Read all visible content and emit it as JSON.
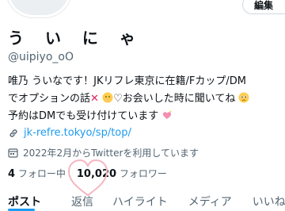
{
  "header": {
    "edit_label": "編集"
  },
  "profile": {
    "display_name": "う い に ゃ",
    "handle": "@uipiyo_oO",
    "bio_lines": [
      "唯乃 ういなです！JKリフレ東京に在籍/Fカップ/DM",
      "でオプションの話",
      "♡お会いした時に聞いてね",
      "予約はDMでも受け付けています"
    ],
    "link": "jk-refre.tokyo/sp/top/",
    "joined": "2022年2月からTwitterを利用しています"
  },
  "stats": {
    "following_count": "4",
    "following_label": "フォロー中",
    "followers_count": "10,020",
    "followers_label": "フォロワー"
  },
  "tabs": [
    {
      "label": "ポスト"
    },
    {
      "label": "返信"
    },
    {
      "label": "ハイライト"
    },
    {
      "label": "メディア"
    },
    {
      "label": "いいね"
    }
  ],
  "colors": {
    "accent": "#1d9bf0",
    "text": "#0f1419",
    "muted": "#536471",
    "heart_outline": "#f4b6c2"
  }
}
